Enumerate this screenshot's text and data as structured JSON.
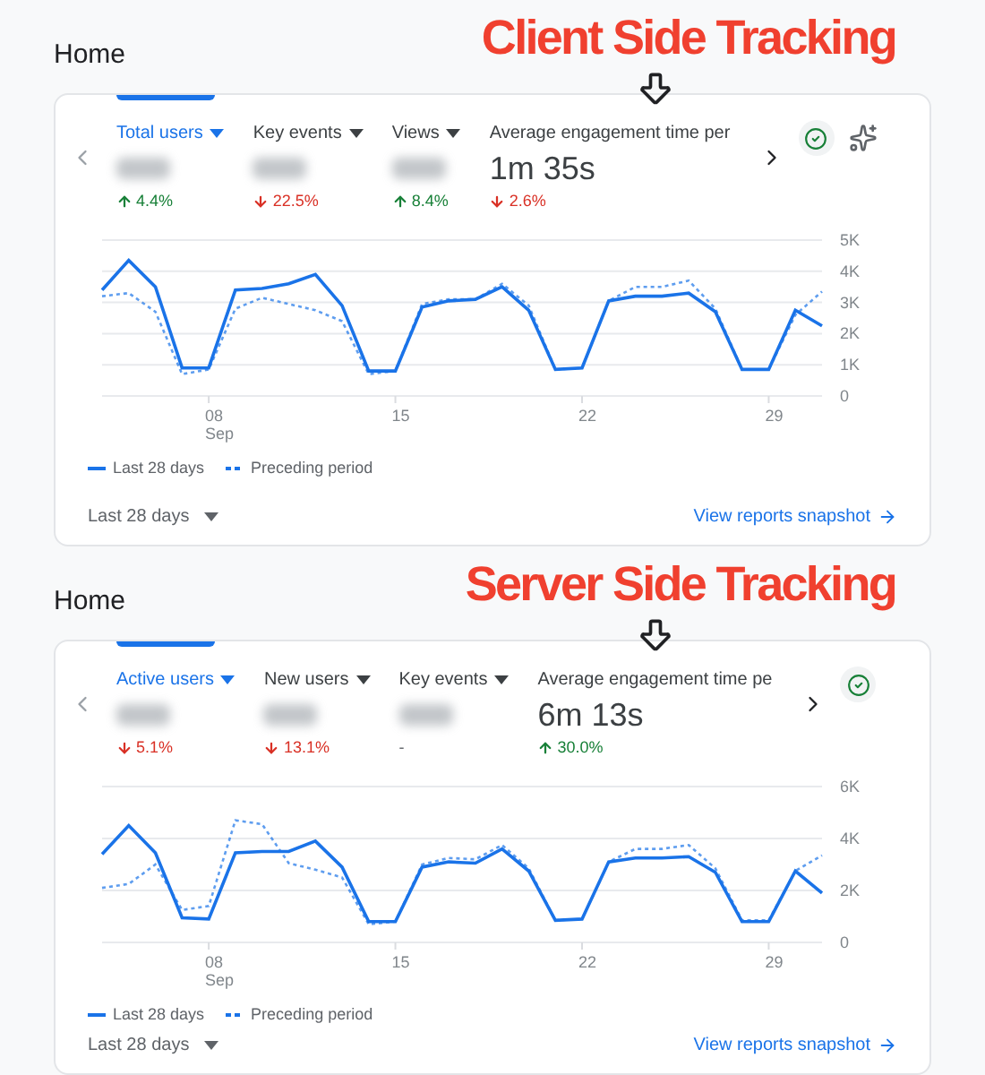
{
  "sections": [
    {
      "page_title": "Home",
      "annotation": "Client Side Tracking",
      "icons": [
        {
          "kind": "check"
        },
        {
          "kind": "sparkle"
        }
      ],
      "metrics": [
        {
          "label": "Total users",
          "selected": true,
          "dropdown": true,
          "change": "4.4%",
          "trend_up": true
        },
        {
          "label": "Key events",
          "selected": false,
          "dropdown": true,
          "change": "22.5%",
          "trend_up": false
        },
        {
          "label": "Views",
          "selected": false,
          "dropdown": true,
          "change": "8.4%",
          "trend_up": true
        },
        {
          "label": "Average engagement time per",
          "selected": false,
          "dropdown": false,
          "value": "1m 35s",
          "change": "2.6%",
          "trend_up": false
        }
      ],
      "month_label": "Sep",
      "chart_data": {
        "type": "line",
        "x": [
          4,
          5,
          6,
          7,
          8,
          9,
          10,
          11,
          12,
          13,
          14,
          15,
          16,
          17,
          18,
          19,
          20,
          21,
          22,
          23,
          24,
          25,
          26,
          27,
          28,
          29,
          30,
          31
        ],
        "xlim": [
          4,
          31
        ],
        "ylim": [
          0,
          5000
        ],
        "grid": true,
        "xticks": [
          {
            "value": 8,
            "label": "08"
          },
          {
            "value": 15,
            "label": "15"
          },
          {
            "value": 22,
            "label": "22"
          },
          {
            "value": 29,
            "label": "29"
          }
        ],
        "yticks": [
          {
            "value": 0,
            "label": "0"
          },
          {
            "value": 1000,
            "label": "1K"
          },
          {
            "value": 2000,
            "label": "2K"
          },
          {
            "value": 3000,
            "label": "3K"
          },
          {
            "value": 4000,
            "label": "4K"
          },
          {
            "value": 5000,
            "label": "5K"
          }
        ],
        "series": [
          {
            "name": "Last 28 days",
            "color": "#1a73e8",
            "line_style": "solid",
            "values": [
              3400,
              4350,
              3500,
              900,
              900,
              3400,
              3450,
              3600,
              3900,
              2900,
              800,
              800,
              2850,
              3050,
              3100,
              3500,
              2750,
              850,
              900,
              3050,
              3200,
              3200,
              3300,
              2700,
              850,
              850,
              2750,
              2250
            ]
          },
          {
            "name": "Preceding period",
            "color": "#1a73e8",
            "line_style": "dotted",
            "values": [
              3200,
              3300,
              2700,
              700,
              850,
              2800,
              3150,
              2950,
              2750,
              2400,
              700,
              800,
              2950,
              3100,
              3100,
              3600,
              2900,
              850,
              900,
              3050,
              3500,
              3500,
              3700,
              2800,
              850,
              850,
              2600,
              3350
            ]
          }
        ]
      },
      "date_range": "Last 28 days",
      "link": "View reports snapshot"
    },
    {
      "page_title": "Home",
      "annotation": "Server Side Tracking",
      "icons": [
        {
          "kind": "check"
        }
      ],
      "metrics": [
        {
          "label": "Active users",
          "selected": true,
          "dropdown": true,
          "change": "5.1%",
          "trend_up": false
        },
        {
          "label": "New users",
          "selected": false,
          "dropdown": true,
          "change": "13.1%",
          "trend_up": false
        },
        {
          "label": "Key events",
          "selected": false,
          "dropdown": true,
          "change": "-"
        },
        {
          "label": "Average engagement time pe",
          "selected": false,
          "dropdown": false,
          "value": "6m 13s",
          "change": "30.0%",
          "trend_up": true
        }
      ],
      "month_label": "Sep",
      "chart_data": {
        "type": "line",
        "x": [
          4,
          5,
          6,
          7,
          8,
          9,
          10,
          11,
          12,
          13,
          14,
          15,
          16,
          17,
          18,
          19,
          20,
          21,
          22,
          23,
          24,
          25,
          26,
          27,
          28,
          29,
          30,
          31
        ],
        "xlim": [
          4,
          31
        ],
        "ylim": [
          0,
          6000
        ],
        "grid": true,
        "xticks": [
          {
            "value": 8,
            "label": "08"
          },
          {
            "value": 15,
            "label": "15"
          },
          {
            "value": 22,
            "label": "22"
          },
          {
            "value": 29,
            "label": "29"
          }
        ],
        "yticks": [
          {
            "value": 0,
            "label": "0"
          },
          {
            "value": 2000,
            "label": "2K"
          },
          {
            "value": 4000,
            "label": "4K"
          },
          {
            "value": 6000,
            "label": "6K"
          }
        ],
        "series": [
          {
            "name": "Last 28 days",
            "color": "#1a73e8",
            "line_style": "solid",
            "values": [
              3400,
              4500,
              3450,
              950,
              900,
              3450,
              3500,
              3500,
              3900,
              2900,
              800,
              800,
              2900,
              3100,
              3050,
              3600,
              2750,
              850,
              900,
              3100,
              3250,
              3250,
              3300,
              2700,
              800,
              800,
              2750,
              1900
            ]
          },
          {
            "name": "Preceding period",
            "color": "#1a73e8",
            "line_style": "dotted",
            "values": [
              2100,
              2250,
              3000,
              1250,
              1400,
              4700,
              4550,
              3050,
              2800,
              2500,
              700,
              800,
              3000,
              3250,
              3200,
              3750,
              2850,
              850,
              900,
              3100,
              3600,
              3600,
              3750,
              2850,
              850,
              850,
              2750,
              3350
            ]
          }
        ]
      },
      "date_range": "Last 28 days",
      "link": "View reports snapshot"
    }
  ]
}
